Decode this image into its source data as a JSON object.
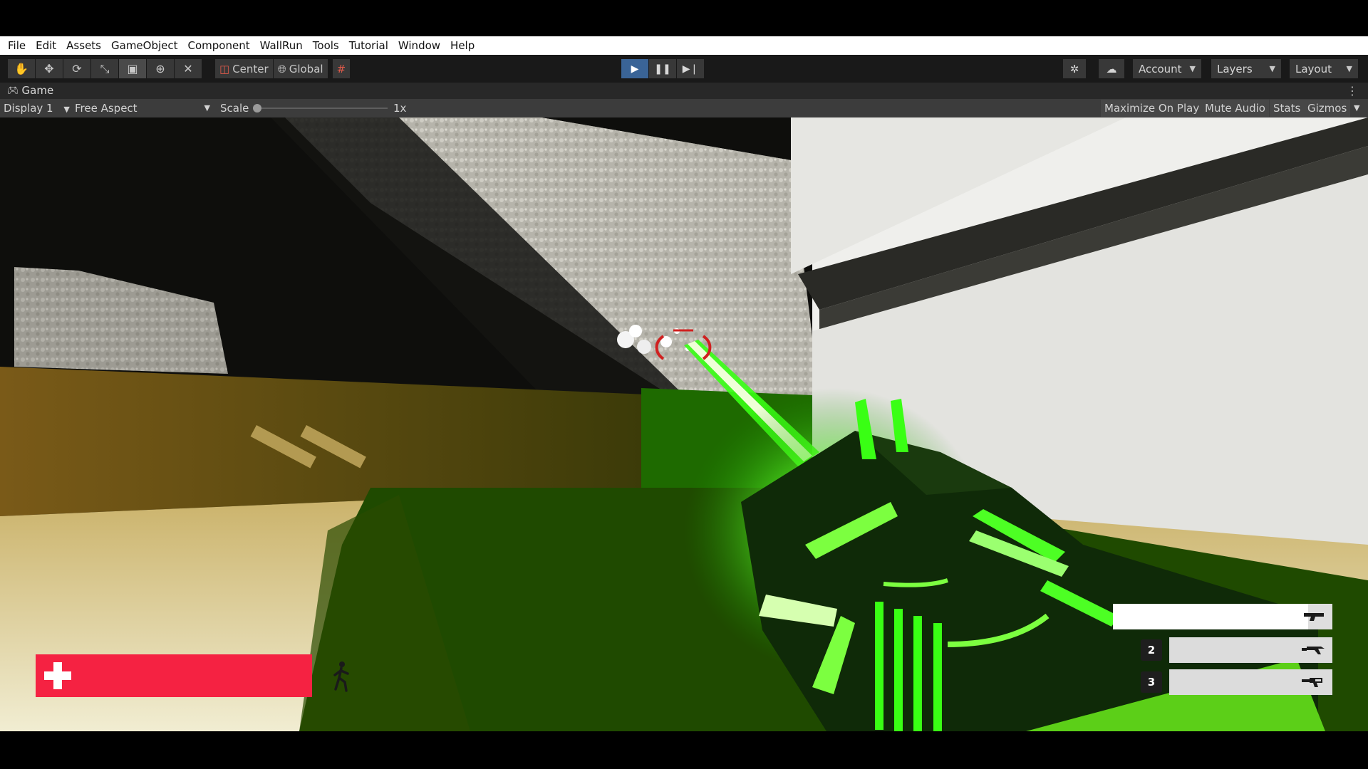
{
  "menu": [
    "File",
    "Edit",
    "Assets",
    "GameObject",
    "Component",
    "WallRun",
    "Tools",
    "Tutorial",
    "Window",
    "Help"
  ],
  "toolbar": {
    "tools": [
      "hand-icon",
      "move-icon",
      "rotate-icon",
      "scale-icon",
      "rect-icon",
      "transform-icon",
      "custom-tool-icon"
    ],
    "pivot_label": "Center",
    "space_label": "Global",
    "account_label": "Account",
    "layers_label": "Layers",
    "layout_label": "Layout"
  },
  "game_tab": {
    "title": "Game",
    "display": "Display 1",
    "aspect": "Free Aspect",
    "scale_label": "Scale",
    "scale_value": "1x",
    "maximize": "Maximize On Play",
    "mute": "Mute Audio",
    "stats": "Stats",
    "gizmos": "Gizmos"
  },
  "hud": {
    "health_fraction": 1.0,
    "weapons": [
      {
        "slot": "",
        "selected": true
      },
      {
        "slot": "2",
        "selected": false
      },
      {
        "slot": "3",
        "selected": false
      }
    ]
  },
  "colors": {
    "play_active": "#3a6497",
    "health": "#f52242",
    "laser": "#39ff14",
    "crosshair": "#d0201f"
  }
}
